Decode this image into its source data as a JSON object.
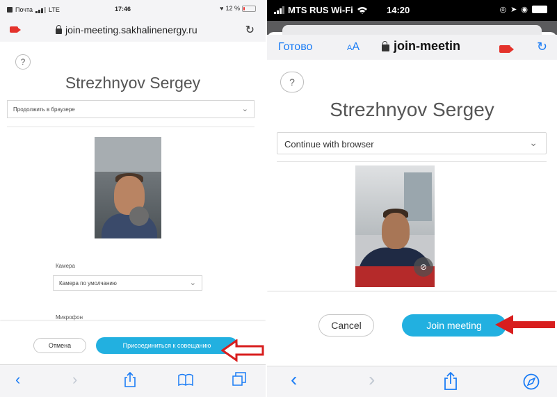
{
  "left": {
    "status": {
      "carrier": "Почта",
      "network": "LTE",
      "time": "17:46",
      "battery_text": "12 %",
      "battery_level": 0.12
    },
    "url_host": "join-meeting.sakhalinenergy.ru",
    "help_glyph": "?",
    "user_name": "Strezhnyov Sergey",
    "join_mode": "Продолжить в браузере",
    "camera_label": "Камера",
    "camera_value": "Камера по умолчанию",
    "microphone_label": "Микрофон",
    "cancel_label": "Отмена",
    "join_label": "Присоединиться к совещанию"
  },
  "right": {
    "status": {
      "carrier": "MTS RUS Wi-Fi",
      "time": "14:20"
    },
    "nav": {
      "done_label": "Готово",
      "aa_label_small": "A",
      "aa_label_big": "A",
      "url_host": "join-meetin"
    },
    "help_glyph": "?",
    "user_name": "Strezhnyov Sergey",
    "join_mode": "Continue with browser",
    "cancel_label": "Cancel",
    "join_label": "Join meeting"
  },
  "icons": {
    "back": "‹",
    "forward": "›",
    "share": "share-icon",
    "bookmarks": "book-icon",
    "tabs": "tabs-icon",
    "compass": "compass-icon",
    "reload": "↻",
    "chevron": "⌄"
  },
  "colors": {
    "accent": "#1a7cf5",
    "join_button": "#22b0e0",
    "camera_red": "#e4322b",
    "arrow_red": "#d81e1e"
  }
}
